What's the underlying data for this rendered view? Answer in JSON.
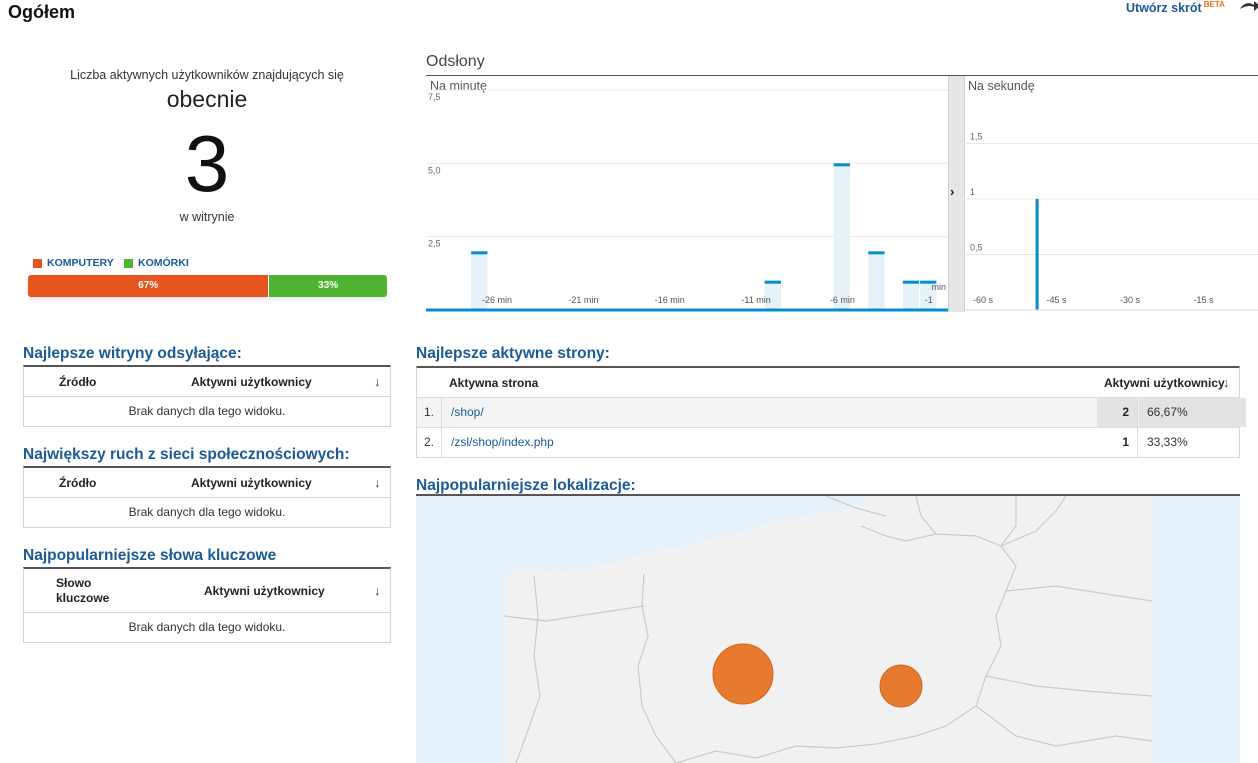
{
  "header": {
    "title": "Ogółem",
    "shortcut_label": "Utwórz skrót",
    "shortcut_badge": "BETA"
  },
  "active_users": {
    "caption": "Liczba aktywnych użytkowników znajdujących się",
    "now_label": "obecnie",
    "count": "3",
    "onsite_label": "w witrynie",
    "devices": [
      {
        "name": "KOMPUTERY",
        "percent": 67,
        "label": "67%",
        "color": "#e8541e"
      },
      {
        "name": "KOMÓRKI",
        "percent": 33,
        "label": "33%",
        "color": "#50b432"
      }
    ]
  },
  "pageviews": {
    "title": "Odsłony",
    "per_minute_label": "Na minutę",
    "per_second_label": "Na sekundę"
  },
  "chart_data": [
    {
      "type": "bar",
      "xlabel": "",
      "ylabel": "",
      "y_ticks": [
        "2,5",
        "5,0",
        "7,5"
      ],
      "ylim": [
        0,
        7.5
      ],
      "x_ticks": [
        {
          "label": "-26 min",
          "minute": -26
        },
        {
          "label": "-21 min",
          "minute": -21
        },
        {
          "label": "-16 min",
          "minute": -16
        },
        {
          "label": "-11 min",
          "minute": -11
        },
        {
          "label": "-6 min",
          "minute": -6
        },
        {
          "label": "-1",
          "minute": -1
        }
      ],
      "unit_label": "min",
      "bars": [
        {
          "minute": -27,
          "value": 2
        },
        {
          "minute": -10,
          "value": 1
        },
        {
          "minute": -6,
          "value": 5
        },
        {
          "minute": -4,
          "value": 2
        },
        {
          "minute": -2,
          "value": 1
        },
        {
          "minute": -1,
          "value": 1
        }
      ],
      "xlim": [
        -30,
        0
      ],
      "color": "#058dc7"
    },
    {
      "type": "bar",
      "xlabel": "",
      "ylabel": "",
      "y_ticks": [
        "0,5",
        "1",
        "1,5"
      ],
      "ylim": [
        0,
        2
      ],
      "x_ticks": [
        {
          "label": "-60 s",
          "second": -60
        },
        {
          "label": "-45 s",
          "second": -45
        },
        {
          "label": "-30 s",
          "second": -30
        },
        {
          "label": "-15 s",
          "second": -15
        }
      ],
      "bars": [
        {
          "second": -46,
          "value": 1
        }
      ],
      "xlim": [
        -60,
        0
      ],
      "color": "#058dc7"
    }
  ],
  "referrals": {
    "title": "Najlepsze witryny odsyłające:",
    "col_source": "Źródło",
    "col_users": "Aktywni użytkownicy",
    "empty": "Brak danych dla tego widoku."
  },
  "social": {
    "title": "Największy ruch z sieci społecznościowych:",
    "col_source": "Źródło",
    "col_users": "Aktywni użytkownicy",
    "empty": "Brak danych dla tego widoku."
  },
  "keywords": {
    "title": "Najpopularniejsze słowa kluczowe",
    "col_keyword": "Słowo kluczowe",
    "col_users": "Aktywni użytkownicy",
    "empty": "Brak danych dla tego widoku."
  },
  "top_pages": {
    "title": "Najlepsze aktywne strony:",
    "col_page": "Aktywna strona",
    "col_users": "Aktywni użytkownicy",
    "rows": [
      {
        "rank": "1.",
        "url": "/shop/",
        "users": "2",
        "percent": "66,67%"
      },
      {
        "rank": "2.",
        "url": "/zsl/shop/index.php",
        "users": "1",
        "percent": "33,33%"
      }
    ]
  },
  "locations": {
    "title": "Najpopularniejsze lokalizacje:"
  }
}
